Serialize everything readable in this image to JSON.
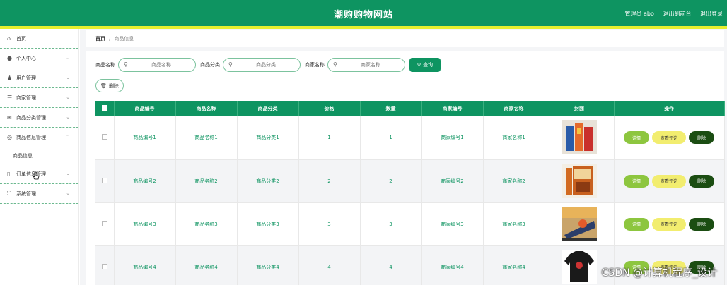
{
  "header": {
    "title": "潮购购物网站",
    "admin_label": "管理员 abo",
    "back_label": "退出到前台",
    "logout_label": "退出登录"
  },
  "sidebar": {
    "items": [
      {
        "label": "首页",
        "icon": "home-icon"
      },
      {
        "label": "个人中心",
        "icon": "user-icon"
      },
      {
        "label": "用户管理",
        "icon": "users-icon"
      },
      {
        "label": "商家管理",
        "icon": "list-icon"
      },
      {
        "label": "商品分类管理",
        "icon": "mail-icon"
      },
      {
        "label": "商品信息管理",
        "icon": "compass-icon"
      },
      {
        "label": "商品信息",
        "icon": ""
      },
      {
        "label": "订单信息管理",
        "icon": "phone-icon"
      },
      {
        "label": "系统管理",
        "icon": "fullscreen-icon"
      }
    ]
  },
  "breadcrumb": {
    "home": "首页",
    "separator": "/",
    "current": "商品信息"
  },
  "search": {
    "label1": "商品名称",
    "placeholder1": "商品名称",
    "label2": "商品分类",
    "placeholder2": "商品分类",
    "label3": "商家名称",
    "placeholder3": "商家名称",
    "query_label": "查询"
  },
  "actions": {
    "delete_label": "删除"
  },
  "table": {
    "headers": [
      "商品编号",
      "商品名称",
      "商品分类",
      "价格",
      "数量",
      "商家编号",
      "商家名称",
      "封面",
      "操作"
    ],
    "rows": [
      [
        "商品编号1",
        "商品名称1",
        "商品分类1",
        "1",
        "1",
        "商家编号1",
        "商家名称1"
      ],
      [
        "商品编号2",
        "商品名称2",
        "商品分类2",
        "2",
        "2",
        "商家编号2",
        "商家名称2"
      ],
      [
        "商品编号3",
        "商品名称3",
        "商品分类3",
        "3",
        "3",
        "商家编号3",
        "商家名称3"
      ],
      [
        "商品编号4",
        "商品名称4",
        "商品分类4",
        "4",
        "4",
        "商家编号4",
        "商家名称4"
      ]
    ],
    "op_detail": "详情",
    "op_review": "查看评论",
    "op_delete": "删除"
  },
  "watermark": "CSDN @计算机程序_设计",
  "colors": {
    "primary": "#0e9461",
    "accent_line": "#e6ef2e",
    "detail_btn": "#8dc63f",
    "review_btn": "#f2ed6f",
    "delete_btn": "#1b4d12"
  }
}
